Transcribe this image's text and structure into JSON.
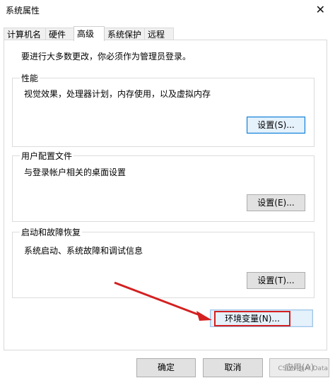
{
  "window": {
    "title": "系统属性"
  },
  "icons": {
    "close": "close-icon"
  },
  "tabs": [
    "计算机名",
    "硬件",
    "高级",
    "系统保护",
    "远程"
  ],
  "intro": "要进行大多数更改，你必须作为管理员登录。",
  "groups": {
    "performance": {
      "label": "性能",
      "description": "视觉效果，处理器计划，内存使用，以及虚拟内存",
      "button": "设置(S)..."
    },
    "user_profiles": {
      "label": "用户配置文件",
      "description": "与登录帐户相关的桌面设置",
      "button": "设置(E)..."
    },
    "startup_recovery": {
      "label": "启动和故障恢复",
      "description": "系统启动、系统故障和调试信息",
      "button": "设置(T)..."
    }
  },
  "env_button": "环境变量(N)...",
  "footer": {
    "ok": "确定",
    "cancel": "取消",
    "apply": "应用(A)"
  },
  "watermark": "CSDN @AI Data",
  "colors": {
    "highlight": "#d42020",
    "focus_border": "#0078d7",
    "button_bg": "#e1e1e1"
  }
}
